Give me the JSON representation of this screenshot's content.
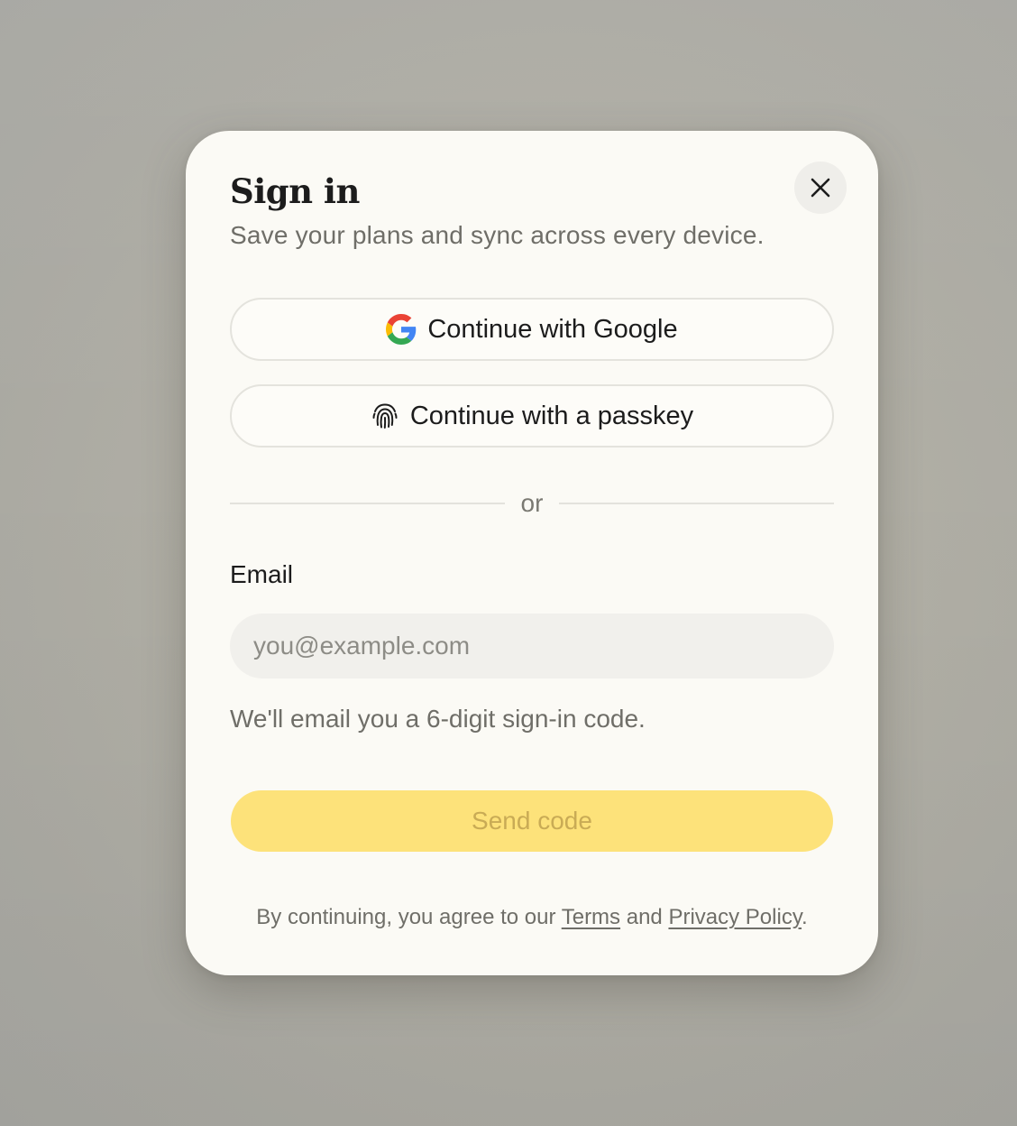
{
  "dialog": {
    "title": "Sign in",
    "subtitle": "Save your plans and sync across every device.",
    "close_icon": "close-icon"
  },
  "oauth": {
    "google_label": "Continue with Google",
    "google_icon": "google-logo-icon",
    "passkey_label": "Continue with a passkey",
    "passkey_icon": "fingerprint-icon"
  },
  "divider": {
    "label": "or"
  },
  "email": {
    "label": "Email",
    "value": "",
    "placeholder": "you@example.com",
    "hint": "We'll email you a 6-digit sign-in code."
  },
  "submit": {
    "label": "Send code",
    "background": "#fde27a",
    "text_color": "#c9ab55"
  },
  "legal": {
    "prefix": "By continuing, you agree to our ",
    "terms_link": "Terms",
    "middle": " and ",
    "privacy_link": "Privacy Policy",
    "suffix": "."
  },
  "colors": {
    "modal_background": "#fbfaf5",
    "backdrop": "#b1afa5",
    "primary_text": "#1c1c1c",
    "secondary_text": "#6f6e68"
  }
}
